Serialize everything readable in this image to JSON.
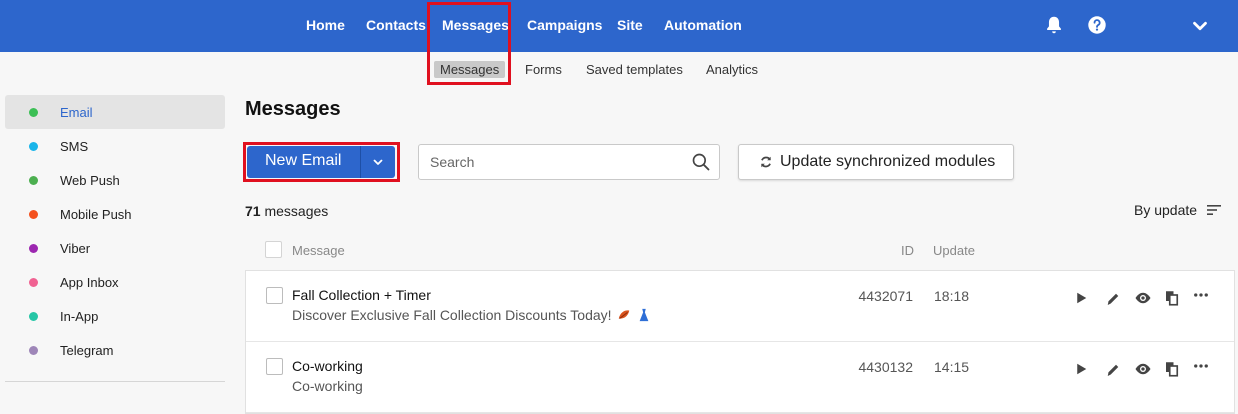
{
  "nav": {
    "items": [
      "Home",
      "Contacts",
      "Messages",
      "Campaigns",
      "Site",
      "Automation"
    ],
    "active": "Messages"
  },
  "subnav": {
    "items": [
      "Messages",
      "Forms",
      "Saved templates",
      "Analytics"
    ],
    "active": "Messages"
  },
  "sidebar": {
    "items": [
      {
        "label": "Email",
        "color": "#3cbf55",
        "active": true
      },
      {
        "label": "SMS",
        "color": "#1ab5ea"
      },
      {
        "label": "Web Push",
        "color": "#4caf50"
      },
      {
        "label": "Mobile Push",
        "color": "#f4511e"
      },
      {
        "label": "Viber",
        "color": "#9c27b0"
      },
      {
        "label": "App Inbox",
        "color": "#f06292"
      },
      {
        "label": "In-App",
        "color": "#26c6a6"
      },
      {
        "label": "Telegram",
        "color": "#9e86b8"
      }
    ]
  },
  "main": {
    "title": "Messages",
    "new_email_label": "New Email",
    "search_placeholder": "Search",
    "sync_label": "Update synchronized modules",
    "count_number": "71",
    "count_suffix": " messages",
    "sort_label": "By update",
    "columns": {
      "message": "Message",
      "id": "ID",
      "update": "Update"
    },
    "rows": [
      {
        "title": "Fall Collection + Timer",
        "subtitle": "Discover Exclusive Fall Collection Discounts Today!",
        "id": "4432071",
        "update": "18:18"
      },
      {
        "title": "Co-working",
        "subtitle": "Co-working",
        "id": "4430132",
        "update": "14:15"
      }
    ]
  },
  "colors": {
    "accent": "#2d66cc",
    "highlight": "#e0101f"
  }
}
